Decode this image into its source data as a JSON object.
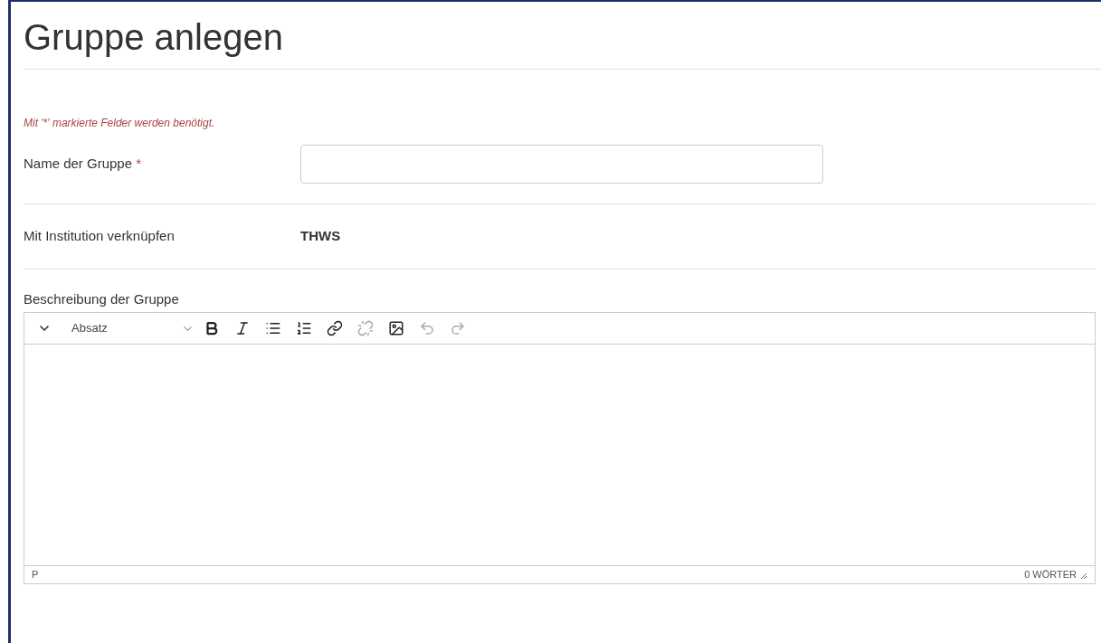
{
  "title": "Gruppe anlegen",
  "required_note": "Mit '*' markierte Felder werden benötigt.",
  "name_field": {
    "label": "Name der Gruppe",
    "required_mark": "*"
  },
  "institution": {
    "label": "Mit Institution verknüpfen",
    "value": "THWS"
  },
  "description": {
    "label": "Beschreibung der Gruppe",
    "format_select": "Absatz",
    "tools": [
      {
        "kind": "bold",
        "disabled": false
      },
      {
        "kind": "italic",
        "disabled": false
      },
      {
        "kind": "bullets",
        "disabled": false
      },
      {
        "kind": "numbers",
        "disabled": false
      },
      {
        "kind": "link",
        "disabled": false
      },
      {
        "kind": "unlink",
        "disabled": true
      },
      {
        "kind": "image",
        "disabled": false
      },
      {
        "kind": "undo",
        "disabled": true
      },
      {
        "kind": "redo",
        "disabled": true
      }
    ],
    "path": "P",
    "word_count": "0 WÖRTER"
  }
}
